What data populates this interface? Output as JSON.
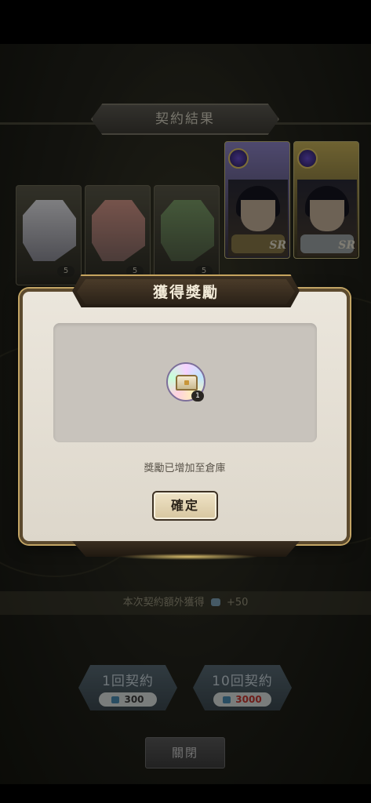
{
  "contract_result": {
    "title": "契約結果",
    "cards": [
      {
        "stars": "5",
        "hair_color": "#e6e6ea",
        "bg_color": "#6d6f7d"
      },
      {
        "stars": "5",
        "hair_color": "#d7988a",
        "bg_color": "#6d5a6a"
      },
      {
        "stars": "5",
        "hair_color": "#7ea06a",
        "bg_color": "#5c6b4f"
      },
      {
        "rarity": "SR",
        "frame_color": "#8f86c9"
      },
      {
        "rarity": "SR",
        "frame_color": "#c9b35a"
      }
    ]
  },
  "bonus": {
    "text": "本次契約額外獲得",
    "amount": "+50"
  },
  "pull_buttons": [
    {
      "label": "1回契約",
      "cost": "300"
    },
    {
      "label": "10回契約",
      "cost": "3000",
      "cost_color": "#c8352f"
    }
  ],
  "close_label": "關閉",
  "dialog": {
    "title": "獲得獎勵",
    "item": {
      "icon": "treasure-chest-icon",
      "quantity": "1"
    },
    "message": "獎勵已增加至倉庫",
    "confirm_label": "確定"
  }
}
